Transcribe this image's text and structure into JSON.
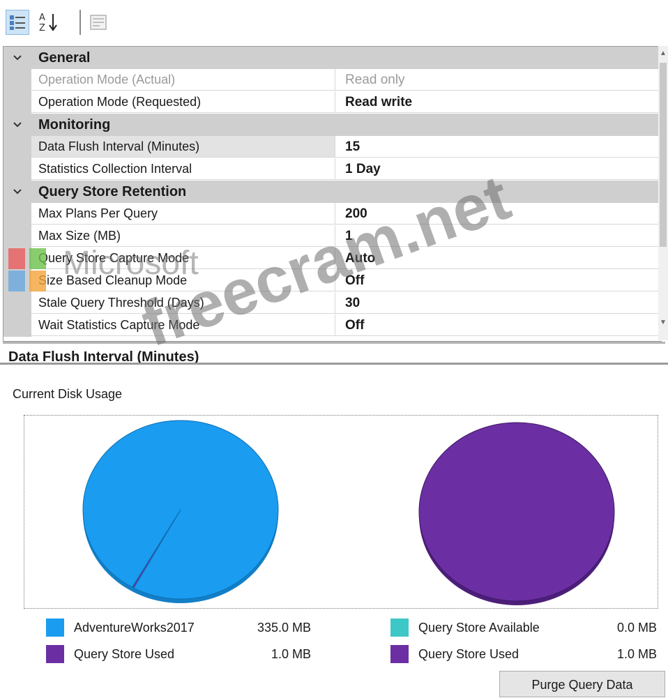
{
  "toolbar": {
    "categorized_icon": "categorized-view-icon",
    "alphabetical_icon": "sort-alphabetical-icon",
    "property_pages_icon": "property-pages-icon"
  },
  "grid": {
    "categories": [
      {
        "label": "General",
        "props": [
          {
            "name": "Operation Mode (Actual)",
            "value": "Read only",
            "readonly": true
          },
          {
            "name": "Operation Mode (Requested)",
            "value": "Read write"
          }
        ]
      },
      {
        "label": "Monitoring",
        "props": [
          {
            "name": "Data Flush Interval (Minutes)",
            "value": "15"
          },
          {
            "name": "Statistics Collection Interval",
            "value": "1 Day"
          }
        ]
      },
      {
        "label": "Query Store Retention",
        "props": [
          {
            "name": "Max Plans Per Query",
            "value": "200"
          },
          {
            "name": "Max Size (MB)",
            "value": "1"
          },
          {
            "name": "Query Store Capture Mode",
            "value": "Auto"
          },
          {
            "name": "Size Based Cleanup Mode",
            "value": "Off"
          },
          {
            "name": "Stale Query Threshold (Days)",
            "value": "30"
          },
          {
            "name": "Wait Statistics Capture Mode",
            "value": "Off"
          }
        ]
      }
    ]
  },
  "description": {
    "title": "Data Flush Interval (Minutes)"
  },
  "disk_usage": {
    "title": "Current Disk Usage",
    "purge_button": "Purge Query Data",
    "legend_left": [
      {
        "label": "AdventureWorks2017",
        "value": "335.0 MB",
        "color": "#1a9cf0"
      },
      {
        "label": "Query Store Used",
        "value": "1.0 MB",
        "color": "#6b2fa3"
      }
    ],
    "legend_right": [
      {
        "label": "Query Store Available",
        "value": "0.0 MB",
        "color": "#3ec7c7"
      },
      {
        "label": "Query Store Used",
        "value": "1.0 MB",
        "color": "#6b2fa3"
      }
    ]
  },
  "chart_data": [
    {
      "type": "pie",
      "categories": [
        "AdventureWorks2017",
        "Query Store Used"
      ],
      "values": [
        335.0,
        1.0
      ],
      "unit": "MB",
      "colors": [
        "#1a9cf0",
        "#6b2fa3"
      ]
    },
    {
      "type": "pie",
      "categories": [
        "Query Store Available",
        "Query Store Used"
      ],
      "values": [
        0.0,
        1.0
      ],
      "unit": "MB",
      "colors": [
        "#3ec7c7",
        "#6b2fa3"
      ]
    }
  ],
  "watermark": {
    "logo_text_1": "Microsoft",
    "logo_text_2": "freecram.net"
  },
  "colors": {
    "category_bg": "#cfcfcf",
    "legend_red": "#e57373",
    "legend_green": "#6cc04a",
    "legend_blue": "#7fb0dc",
    "legend_orange": "#f2a33a"
  }
}
